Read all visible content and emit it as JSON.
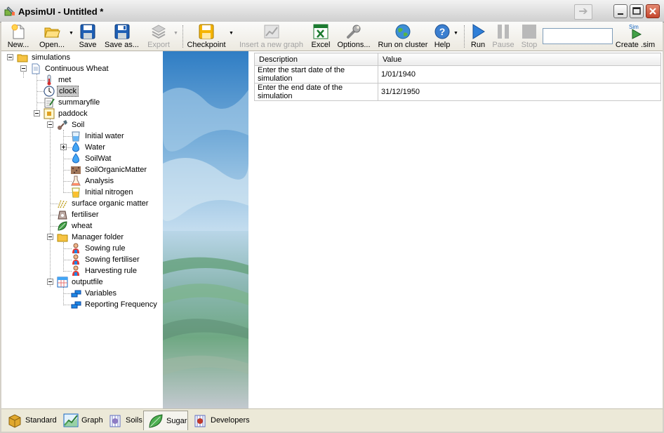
{
  "window": {
    "title": "ApsimUI - Untitled *"
  },
  "toolbar": {
    "new": "New...",
    "open": "Open...",
    "save": "Save",
    "save_as": "Save as...",
    "export": "Export",
    "checkpoint": "Checkpoint",
    "insert_graph": "Insert a new graph",
    "excel": "Excel",
    "options": "Options...",
    "run_cluster": "Run on cluster",
    "help": "Help",
    "run": "Run",
    "pause": "Pause",
    "stop": "Stop",
    "search_value": "",
    "create_sim": "Create .sim",
    "sim_badge": "Sim"
  },
  "tree": {
    "simulations": "simulations",
    "continuous_wheat": "Continuous Wheat",
    "met": "met",
    "clock": "clock",
    "summaryfile": "summaryfile",
    "paddock": "paddock",
    "soil": "Soil",
    "initial_water": "Initial water",
    "water": "Water",
    "soilwat": "SoilWat",
    "soil_organic_matter": "SoilOrganicMatter",
    "analysis": "Analysis",
    "initial_nitrogen": "Initial nitrogen",
    "surface_organic_matter": "surface organic matter",
    "fertiliser": "fertiliser",
    "wheat": "wheat",
    "manager_folder": "Manager folder",
    "sowing_rule": "Sowing rule",
    "sowing_fertiliser": "Sowing fertiliser",
    "harvesting_rule": "Harvesting rule",
    "outputfile": "outputfile",
    "variables": "Variables",
    "reporting_frequency": "Reporting Frequency"
  },
  "grid": {
    "columns": [
      "Description",
      "Value"
    ],
    "rows": [
      {
        "description": "Enter the start date of the simulation",
        "value": "1/01/1940"
      },
      {
        "description": "Enter the end date of the simulation",
        "value": "31/12/1950"
      }
    ]
  },
  "tabs": {
    "standard": "Standard",
    "graph": "Graph",
    "soils": "Soils",
    "sugar": "Sugar",
    "developers": "Developers"
  }
}
